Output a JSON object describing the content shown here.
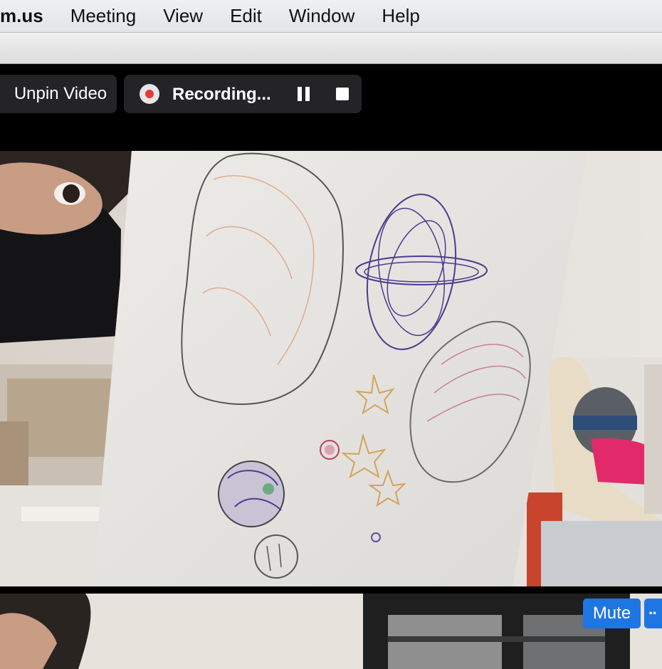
{
  "menubar": {
    "app_name": "m.us",
    "items": [
      "Meeting",
      "View",
      "Edit",
      "Window",
      "Help"
    ]
  },
  "toolbar": {
    "unpin_label": "Unpin Video",
    "recording_label": "Recording...",
    "record_icon": "record-dot-icon",
    "pause_icon": "pause-icon",
    "stop_icon": "stop-icon"
  },
  "thumbnail": {
    "mute_label": "Mute",
    "more_label": "··"
  },
  "colors": {
    "accent_blue": "#1f76e3",
    "record_red": "#e8383d",
    "toolbar_bg": "#242427"
  }
}
